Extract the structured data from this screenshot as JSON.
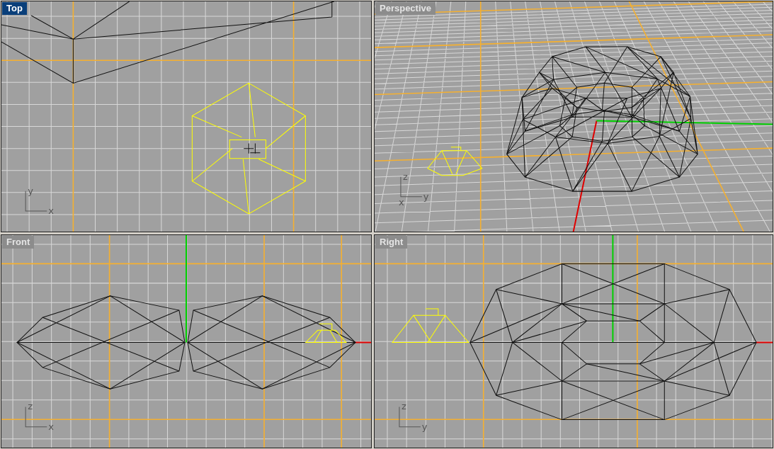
{
  "viewports": [
    {
      "title": "Top",
      "kind": "top",
      "selected": true,
      "axes": [
        "y",
        "x"
      ]
    },
    {
      "title": "Perspective",
      "kind": "perspective",
      "selected": false,
      "axes": [
        "z",
        "x",
        "y"
      ]
    },
    {
      "title": "Front",
      "kind": "front",
      "selected": false,
      "axes": [
        "z",
        "x"
      ]
    },
    {
      "title": "Right",
      "kind": "right",
      "selected": false,
      "axes": [
        "z",
        "y"
      ]
    }
  ]
}
